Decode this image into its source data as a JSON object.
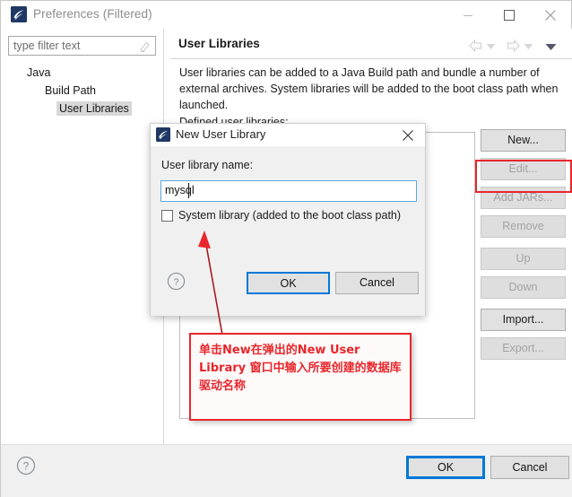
{
  "window": {
    "title": "Preferences (Filtered)",
    "icon": "eclipse-icon",
    "minimize": "minimize-icon",
    "maximize": "maximize-icon",
    "close": "close-icon"
  },
  "filter": {
    "value": "type filter text",
    "placeholder": "type filter text",
    "clear_icon": "clear-filter-icon"
  },
  "tree": [
    {
      "label": "Java",
      "indent": 0,
      "selected": false
    },
    {
      "label": "Build Path",
      "indent": 1,
      "selected": false
    },
    {
      "label": "User Libraries",
      "indent": 2,
      "selected": true
    }
  ],
  "content": {
    "title": "User Libraries",
    "description": "User libraries can be added to a Java Build path and bundle a number of external archives. System libraries will be added to the boot class path when launched.",
    "defined_label": "Defined user libraries:",
    "nav": {
      "back": "back-arrow-icon",
      "back_dropdown": "chevron-down-icon",
      "forward": "forward-arrow-icon",
      "forward_dropdown": "chevron-down-icon",
      "menu": "view-menu-icon"
    }
  },
  "side_buttons": [
    {
      "label": "New...",
      "enabled": true,
      "gap": false,
      "highlighted": true
    },
    {
      "label": "Edit...",
      "enabled": false,
      "gap": false,
      "highlighted": false
    },
    {
      "label": "Add JARs...",
      "enabled": false,
      "gap": false,
      "highlighted": false
    },
    {
      "label": "Remove",
      "enabled": false,
      "gap": false,
      "highlighted": false
    },
    {
      "label": "Up",
      "enabled": false,
      "gap": true,
      "highlighted": false
    },
    {
      "label": "Down",
      "enabled": false,
      "gap": false,
      "highlighted": false
    },
    {
      "label": "Import...",
      "enabled": true,
      "gap": true,
      "highlighted": false
    },
    {
      "label": "Export...",
      "enabled": false,
      "gap": false,
      "highlighted": false
    }
  ],
  "bottom": {
    "help_icon": "help-icon",
    "ok": "OK",
    "cancel": "Cancel"
  },
  "dialog": {
    "title": "New User Library",
    "icon": "eclipse-icon",
    "close": "close-icon",
    "name_label": "User library name:",
    "name_value": "mysql",
    "system_library_label": "System library (added to the boot class path)",
    "system_library_checked": false,
    "help_icon": "help-icon",
    "ok": "OK",
    "cancel": "Cancel"
  },
  "annotation": {
    "text": "单击New在弹出的New User Library 窗口中输入所要创建的数据库驱动名称",
    "color": "#e8262b",
    "arrow": "red-arrow-icon"
  },
  "colors": {
    "accent": "#0078d7",
    "annotation_red": "#e8262b",
    "button_face": "#e1e1e1",
    "disabled_text": "#a3a3a3",
    "panel_bg": "#f0f0f0"
  }
}
